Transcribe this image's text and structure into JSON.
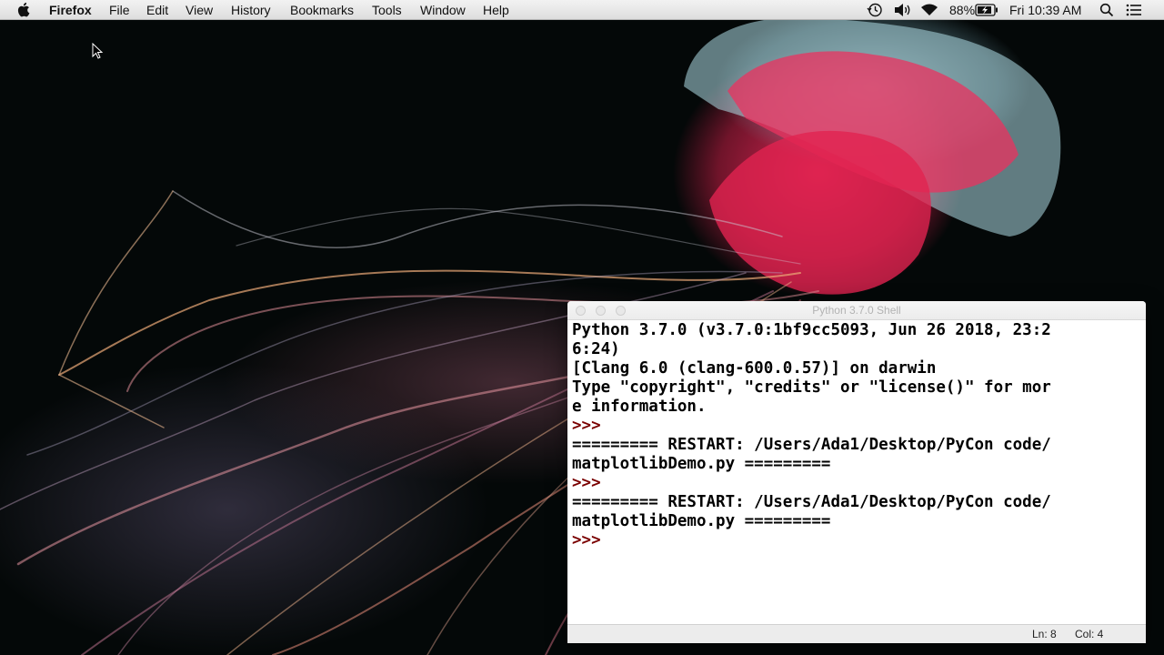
{
  "menubar": {
    "app_name": "Firefox",
    "items": [
      "File",
      "Edit",
      "View",
      "History",
      "Bookmarks",
      "Tools",
      "Window",
      "Help"
    ],
    "battery": "88%",
    "clock": "Fri 10:39 AM",
    "icons": [
      "apple-icon",
      "time-machine-icon",
      "volume-icon",
      "wifi-icon",
      "battery-icon",
      "spotlight-search-icon",
      "notification-center-icon"
    ]
  },
  "desktop": {
    "wallpaper": "jellyfish"
  },
  "shell": {
    "title": "Python 3.7.0 Shell",
    "lines": [
      {
        "text": "Python 3.7.0 (v3.7.0:1bf9cc5093, Jun 26 2018, 23:2"
      },
      {
        "text": "6:24)"
      },
      {
        "text": "[Clang 6.0 (clang-600.0.57)] on darwin"
      },
      {
        "text": "Type \"copyright\", \"credits\" or \"license()\" for mor"
      },
      {
        "text": "e information."
      },
      {
        "text": ">>> ",
        "prompt": true
      },
      {
        "text": "========= RESTART: /Users/Ada1/Desktop/PyCon code/"
      },
      {
        "text": "matplotlibDemo.py ========="
      },
      {
        "text": ">>> ",
        "prompt": true
      },
      {
        "text": "========= RESTART: /Users/Ada1/Desktop/PyCon code/"
      },
      {
        "text": "matplotlibDemo.py ========="
      },
      {
        "text": ">>> ",
        "prompt": true
      }
    ],
    "status": {
      "line": "Ln: 8",
      "col": "Col: 4"
    }
  },
  "colors": {
    "prompt": "#7a0000",
    "menubar_bg": "#ececec",
    "desktop_bg": "#040808"
  }
}
